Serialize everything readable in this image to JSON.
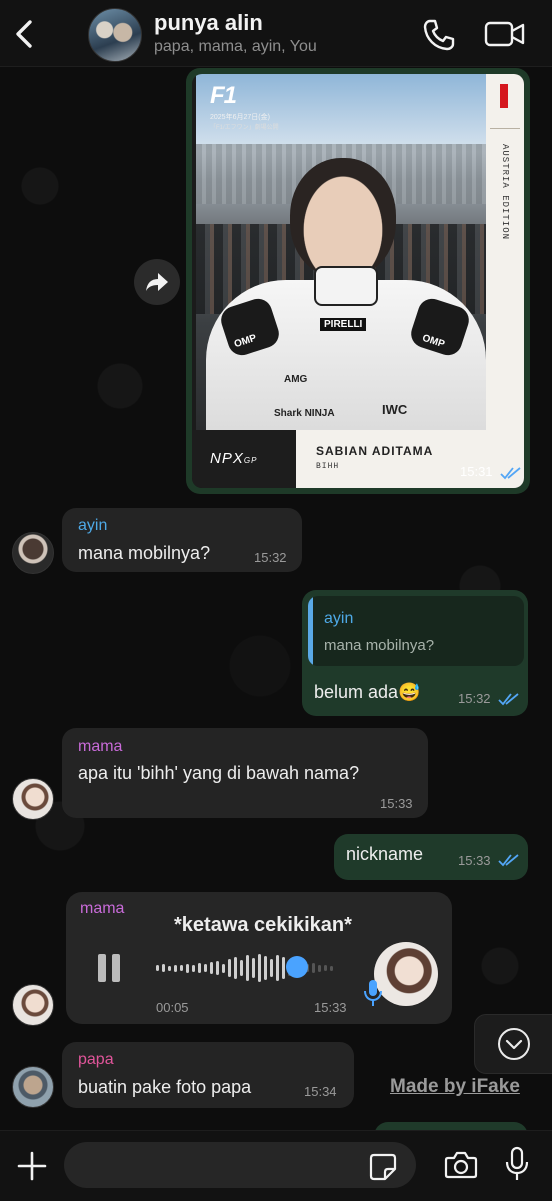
{
  "header": {
    "back_icon": "chevron-left-icon",
    "group_name": "punya alin",
    "members": "papa, mama, ayin, You",
    "call_icon": "phone-icon",
    "video_icon": "video-camera-icon"
  },
  "image_message": {
    "card": {
      "brand": "F1",
      "date": "2025年6月27日(金)",
      "subtitle": "「F1/エフワン」劇場公開",
      "edition": "AUSTRIA EDITION",
      "maker": "NPX",
      "maker_suffix": "GP",
      "name": "SABIAN ADITAMA",
      "nickname": "BIHH",
      "sponsors": [
        "PIRELLI",
        "OMP",
        "OMP",
        "AMG",
        "IWC",
        "Shark NINJA"
      ]
    },
    "time": "15:31",
    "status": "read",
    "forward_icon": "share-arrow-icon"
  },
  "messages": [
    {
      "sender": "ayin",
      "text": "mana mobilnya?",
      "time": "15:32",
      "direction": "in"
    },
    {
      "quote_sender": "ayin",
      "quote_text": "mana mobilnya?",
      "text": "belum ada😅",
      "time": "15:32",
      "direction": "out",
      "status": "read"
    },
    {
      "sender": "mama",
      "text": "apa itu 'bihh' yang di bawah nama?",
      "time": "15:33",
      "direction": "in"
    },
    {
      "text": "nickname",
      "time": "15:33",
      "direction": "out",
      "status": "read"
    },
    {
      "sender": "mama",
      "text": "*ketawa cekikikan*",
      "type": "voice",
      "duration": "00:05",
      "time": "15:33",
      "progress": 0.72,
      "direction": "in"
    },
    {
      "sender": "papa",
      "text": "buatin pake foto papa",
      "time": "15:34",
      "direction": "in"
    }
  ],
  "colors": {
    "ayin": "#4ea9e6",
    "mama": "#c86bd8",
    "papa": "#e0559a",
    "read_ticks": "#53a6f5",
    "outgoing_bubble": "#1f3a2a",
    "incoming_bubble": "#242424"
  },
  "overlay": {
    "scroll_down_icon": "chevron-down-circle-icon",
    "watermark": "Made by iFake"
  },
  "input_bar": {
    "plus_icon": "plus-icon",
    "placeholder": "",
    "sticker_icon": "sticker-icon",
    "camera_icon": "camera-icon",
    "mic_icon": "microphone-icon"
  }
}
